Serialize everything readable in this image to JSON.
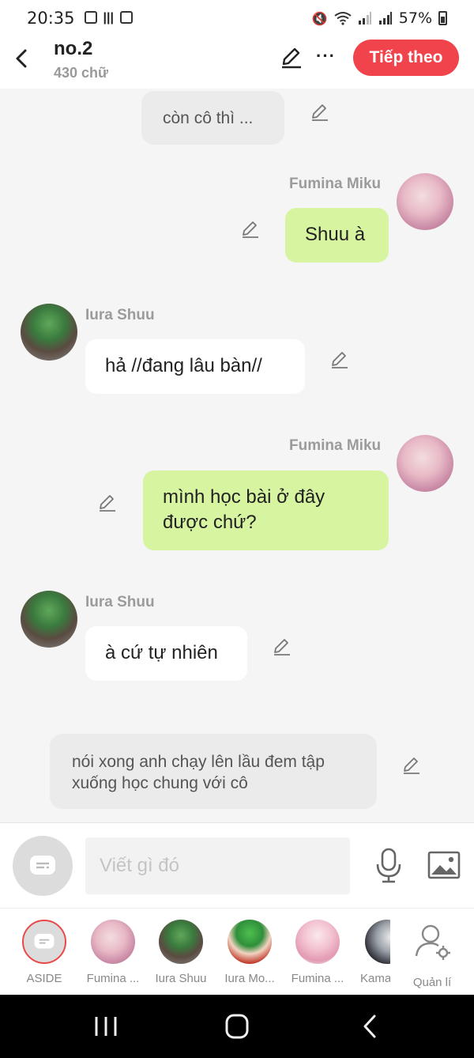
{
  "status_bar": {
    "time": "20:35",
    "battery": "57%"
  },
  "header": {
    "title": "no.2",
    "subtitle": "430 chữ",
    "next_label": "Tiếp theo",
    "more_label": "···"
  },
  "messages": [
    {
      "type": "narration",
      "text": "còn cô thì ..."
    },
    {
      "type": "right",
      "name": "Fumina Miku",
      "text": "Shuu à"
    },
    {
      "type": "left",
      "name": "Iura Shuu",
      "text": "hả //đang lâu bàn//"
    },
    {
      "type": "right",
      "name": "Fumina Miku",
      "text": "mình học bài ở đây được chứ?"
    },
    {
      "type": "left",
      "name": "Iura Shuu",
      "text": "à cứ tự nhiên"
    },
    {
      "type": "narration",
      "text": "nói xong anh chạy lên lầu đem tập xuống học chung với cô"
    }
  ],
  "input": {
    "placeholder": "Viết gì đó",
    "value": ""
  },
  "characters": [
    {
      "label": "ASIDE"
    },
    {
      "label": "Fumina ..."
    },
    {
      "label": "Iura Shuu"
    },
    {
      "label": "Iura Mo..."
    },
    {
      "label": "Fumina ..."
    },
    {
      "label": "Kama"
    },
    {
      "label": "Quản lí"
    }
  ],
  "colors": {
    "accent": "#f0434b",
    "my_bubble": "#d7f4a0",
    "narration_bubble": "#ebebeb"
  }
}
